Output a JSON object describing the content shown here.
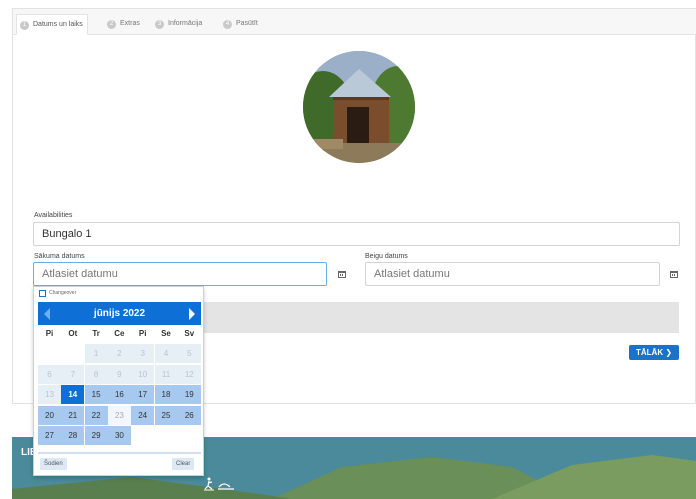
{
  "tabs": [
    {
      "num": "1",
      "label": "Datums un laiks"
    },
    {
      "num": "2",
      "label": "Extras"
    },
    {
      "num": "3",
      "label": "Informācija"
    },
    {
      "num": "4",
      "label": "Pasūtīt"
    }
  ],
  "form": {
    "availabilities_label": "Availabilities",
    "availabilities_value": "Bungalo 1",
    "start_label": "Sākuma datums",
    "start_placeholder": "Atlasiet datumu",
    "end_label": "Beigu datums",
    "end_placeholder": "Atlasiet datumu",
    "next_label": "TĀLĀK ❯"
  },
  "datepicker": {
    "changeover_label": "Changeover",
    "month_title": "jūnijs 2022",
    "weekdays": [
      "Pi",
      "Ot",
      "Tr",
      "Ce",
      "Pi",
      "Se",
      "Sv"
    ],
    "weeks": [
      [
        "",
        "",
        "1",
        "2",
        "3",
        "4",
        "5"
      ],
      [
        "6",
        "7",
        "8",
        "9",
        "10",
        "11",
        "12"
      ],
      [
        "13",
        "14",
        "15",
        "16",
        "17",
        "18",
        "19"
      ],
      [
        "20",
        "21",
        "22",
        "23",
        "24",
        "25",
        "26"
      ],
      [
        "27",
        "28",
        "29",
        "30",
        "",
        "",
        ""
      ]
    ],
    "selected_day": "14",
    "today_label": "Šodien",
    "clear_label": "Clear"
  },
  "footer": {
    "text": "LIE"
  },
  "colors": {
    "accent": "#0e70d6",
    "available": "#a7c8ef",
    "footer_bg": "#4a8a9a"
  }
}
